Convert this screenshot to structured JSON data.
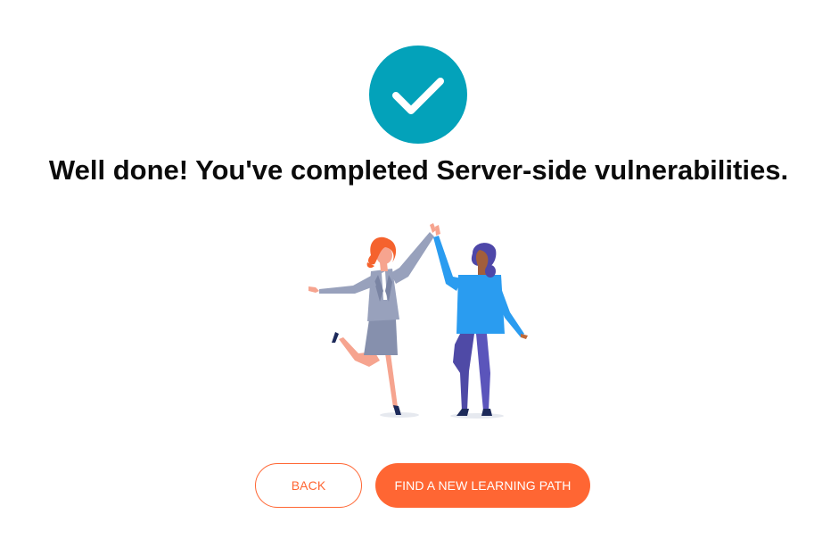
{
  "completion": {
    "icon": "check-circle-icon",
    "heading": "Well done! You've completed Server-side vulnerabilities.",
    "illustration": "high-five-illustration"
  },
  "actions": {
    "back_label": "BACK",
    "find_path_label": "FIND A NEW LEARNING PATH"
  },
  "colors": {
    "accent": "#ff6633",
    "check_circle": "#03a2ba",
    "heading_text": "#0b0b0b"
  }
}
